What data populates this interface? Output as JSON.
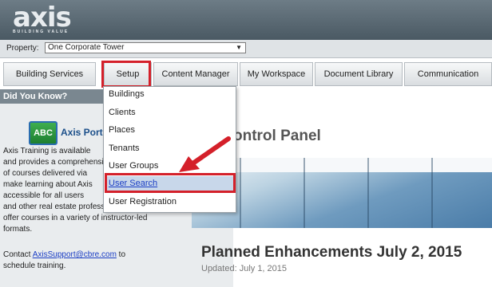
{
  "brand": {
    "logo_text": "axis",
    "tagline": "BUILDING VALUE"
  },
  "property": {
    "label": "Property:",
    "selected": "One Corporate Tower"
  },
  "nav": {
    "tabs": [
      {
        "label": "Building Services"
      },
      {
        "label": "Setup"
      },
      {
        "label": "Content Manager"
      },
      {
        "label": "My Workspace"
      },
      {
        "label": "Document Library"
      },
      {
        "label": "Communication"
      }
    ]
  },
  "setup_menu": {
    "items": [
      {
        "label": "Buildings"
      },
      {
        "label": "Clients"
      },
      {
        "label": "Places"
      },
      {
        "label": "Tenants"
      },
      {
        "label": "User Groups"
      },
      {
        "label": "User Search"
      },
      {
        "label": "User Registration"
      }
    ],
    "highlighted": "User Search"
  },
  "sidebar": {
    "heading": "Did You Know?",
    "icon_text": "ABC",
    "portal_title": "Axis Portal",
    "lines": [
      "Axis Training is available",
      "and provides a comprehensive",
      "of courses delivered via",
      "make learning about Axis",
      "accessible for all users",
      "and other real estate professionals, we",
      "offer courses in a variety of instructor-led",
      "formats."
    ],
    "contact_prefix": "Contact ",
    "contact_email": "AxisSupport@cbre.com",
    "contact_suffix": " to",
    "contact_line2": "schedule training."
  },
  "main": {
    "title": "ontrol Panel",
    "headline": "Planned Enhancements July 2, 2015",
    "updated": "Updated: July 1, 2015"
  },
  "colors": {
    "highlight": "#d4202a",
    "header": "#5a6973",
    "link": "#1a3dc4"
  }
}
